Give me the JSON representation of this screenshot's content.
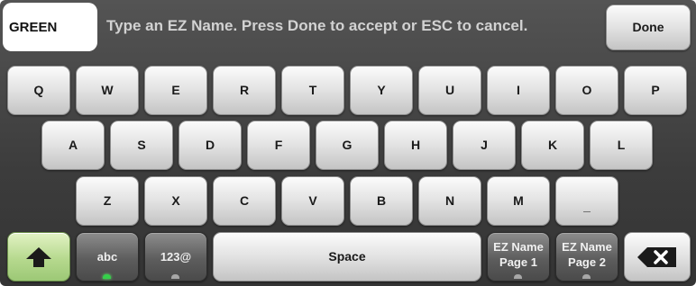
{
  "name_field": {
    "value": "GREEN"
  },
  "instruction": "Type an EZ Name.  Press Done to accept or ESC to cancel.",
  "done_label": "Done",
  "rows": [
    [
      "Q",
      "W",
      "E",
      "R",
      "T",
      "Y",
      "U",
      "I",
      "O",
      "P"
    ],
    [
      "A",
      "S",
      "D",
      "F",
      "G",
      "H",
      "J",
      "K",
      "L"
    ],
    [
      "Z",
      "X",
      "C",
      "V",
      "B",
      "N",
      "M",
      "_"
    ]
  ],
  "bottom": {
    "shift_icon": "up-arrow-icon",
    "abc_label": "abc",
    "abc_active": true,
    "num_label": "123@",
    "num_active": false,
    "space_label": "Space",
    "ez_page1_label": "EZ Name\nPage 1",
    "ez_page1_active": false,
    "ez_page2_label": "EZ Name\nPage 2",
    "ez_page2_active": false,
    "backspace_icon": "backspace-icon"
  },
  "colors": {
    "background": "#3c3c3c",
    "shift_key": "#b6d98e",
    "indicator_on": "#35d04a",
    "indicator_off": "#a7a7a7"
  }
}
